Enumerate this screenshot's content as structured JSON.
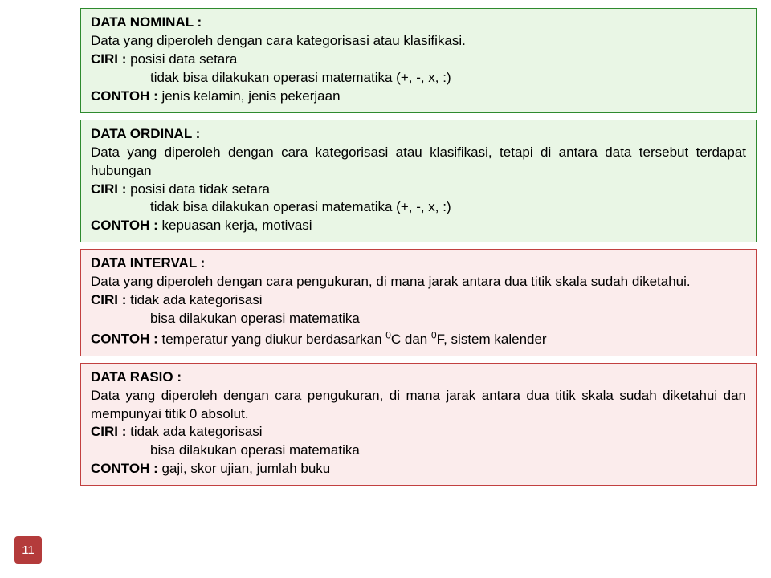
{
  "page_number": "11",
  "boxes": [
    {
      "variant": "green",
      "title": "DATA NOMINAL :",
      "desc": "Data yang diperoleh dengan cara kategorisasi atau klasifikasi.",
      "ciri_label": "CIRI :",
      "ciri1": "posisi data setara",
      "ciri2": "tidak bisa dilakukan operasi matematika (+, -, x, :)",
      "contoh_label": "CONTOH :",
      "contoh": "jenis kelamin, jenis pekerjaan"
    },
    {
      "variant": "green",
      "title": "DATA ORDINAL :",
      "desc": "Data yang diperoleh dengan cara kategorisasi atau klasifikasi, tetapi di antara data tersebut terdapat hubungan",
      "ciri_label": "CIRI :",
      "ciri1": "posisi data tidak setara",
      "ciri2": "tidak bisa dilakukan operasi matematika (+, -, x, :)",
      "contoh_label": "CONTOH :",
      "contoh": "kepuasan kerja, motivasi"
    },
    {
      "variant": "pink",
      "title": "DATA INTERVAL :",
      "desc": "Data yang diperoleh dengan cara pengukuran, di mana jarak antara dua titik skala sudah diketahui.",
      "ciri_label": "CIRI :",
      "ciri1": "tidak ada kategorisasi",
      "ciri2": "bisa dilakukan operasi matematika",
      "contoh_label": "CONTOH :",
      "contoh_html": "temperatur yang diukur berdasarkan <span class=\"sup\">0</span>C dan <span class=\"sup\">0</span>F, sistem kalender"
    },
    {
      "variant": "pink",
      "title": "DATA RASIO :",
      "desc": "Data yang diperoleh dengan cara pengukuran, di mana jarak antara dua titik skala sudah diketahui dan mempunyai titik 0 absolut.",
      "ciri_label": "CIRI :",
      "ciri1": "tidak ada kategorisasi",
      "ciri2": "bisa dilakukan operasi matematika",
      "contoh_label": "CONTOH :",
      "contoh": "gaji, skor ujian, jumlah buku"
    }
  ]
}
